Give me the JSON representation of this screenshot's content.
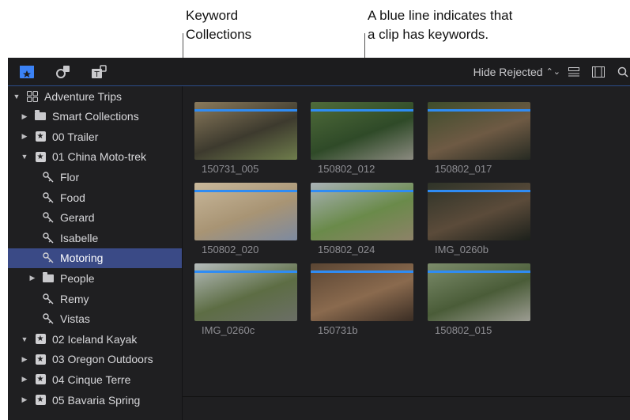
{
  "callouts": {
    "keyword_collections": "Keyword\nCollections",
    "blue_line": "A blue line indicates that\na clip has keywords."
  },
  "toolbar": {
    "icons": [
      "libraries-icon",
      "photos-audio-icon",
      "titles-generators-icon"
    ],
    "filter_label": "Hide Rejected",
    "right_icons": [
      "clip-appearance-icon",
      "filmstrip-icon",
      "search-icon"
    ]
  },
  "sidebar": {
    "items": [
      {
        "label": "Adventure Trips",
        "level": 0,
        "disclosure": "open",
        "icon": "library-icon"
      },
      {
        "label": "Smart Collections",
        "level": 1,
        "disclosure": "closed",
        "icon": "folder-icon"
      },
      {
        "label": "00 Trailer",
        "level": 1,
        "disclosure": "closed",
        "icon": "event-icon"
      },
      {
        "label": "01 China Moto-trek",
        "level": 1,
        "disclosure": "open",
        "icon": "event-icon"
      },
      {
        "label": "Flor",
        "level": 2,
        "disclosure": "none",
        "icon": "keyword-icon"
      },
      {
        "label": "Food",
        "level": 2,
        "disclosure": "none",
        "icon": "keyword-icon"
      },
      {
        "label": "Gerard",
        "level": 2,
        "disclosure": "none",
        "icon": "keyword-icon"
      },
      {
        "label": "Isabelle",
        "level": 2,
        "disclosure": "none",
        "icon": "keyword-icon"
      },
      {
        "label": "Motoring",
        "level": 2,
        "disclosure": "none",
        "icon": "keyword-icon",
        "selected": true
      },
      {
        "label": "People",
        "level": 2,
        "disclosure": "closed",
        "icon": "folder-icon"
      },
      {
        "label": "Remy",
        "level": 2,
        "disclosure": "none",
        "icon": "keyword-icon"
      },
      {
        "label": "Vistas",
        "level": 2,
        "disclosure": "none",
        "icon": "keyword-icon"
      },
      {
        "label": "02 Iceland Kayak",
        "level": 1,
        "disclosure": "open",
        "icon": "event-icon"
      },
      {
        "label": "03 Oregon Outdoors",
        "level": 1,
        "disclosure": "closed",
        "icon": "event-icon"
      },
      {
        "label": "04 Cinque Terre",
        "level": 1,
        "disclosure": "closed",
        "icon": "event-icon"
      },
      {
        "label": "05 Bavaria Spring",
        "level": 1,
        "disclosure": "closed",
        "icon": "event-icon"
      }
    ]
  },
  "clips": [
    {
      "name": "150731_005",
      "colors": [
        "#8a7a5c",
        "#3d3a2e",
        "#6f7d4c"
      ]
    },
    {
      "name": "150802_012",
      "colors": [
        "#4f6b3a",
        "#2f4a28",
        "#8b8a80"
      ]
    },
    {
      "name": "150802_017",
      "colors": [
        "#3e4d2c",
        "#6e5a44",
        "#262a22"
      ]
    },
    {
      "name": "150802_020",
      "colors": [
        "#c9b89b",
        "#a89474",
        "#7d8aa0"
      ]
    },
    {
      "name": "150802_024",
      "colors": [
        "#a9b2b7",
        "#6a8a4a",
        "#8d8268"
      ]
    },
    {
      "name": "IMG_0260b",
      "colors": [
        "#2e3328",
        "#5b4b3a",
        "#1c201b"
      ]
    },
    {
      "name": "IMG_0260c",
      "colors": [
        "#b5bcbc",
        "#5d6d44",
        "#6b6e66"
      ]
    },
    {
      "name": "150731b",
      "colors": [
        "#5a4533",
        "#8a6a4e",
        "#3a2d24"
      ]
    },
    {
      "name": "150802_015",
      "colors": [
        "#7c8c6b",
        "#4a5c38",
        "#9c9c92"
      ]
    }
  ],
  "colors": {
    "keyword_line": "#2f8cf4",
    "selection": "#3a4a86"
  }
}
